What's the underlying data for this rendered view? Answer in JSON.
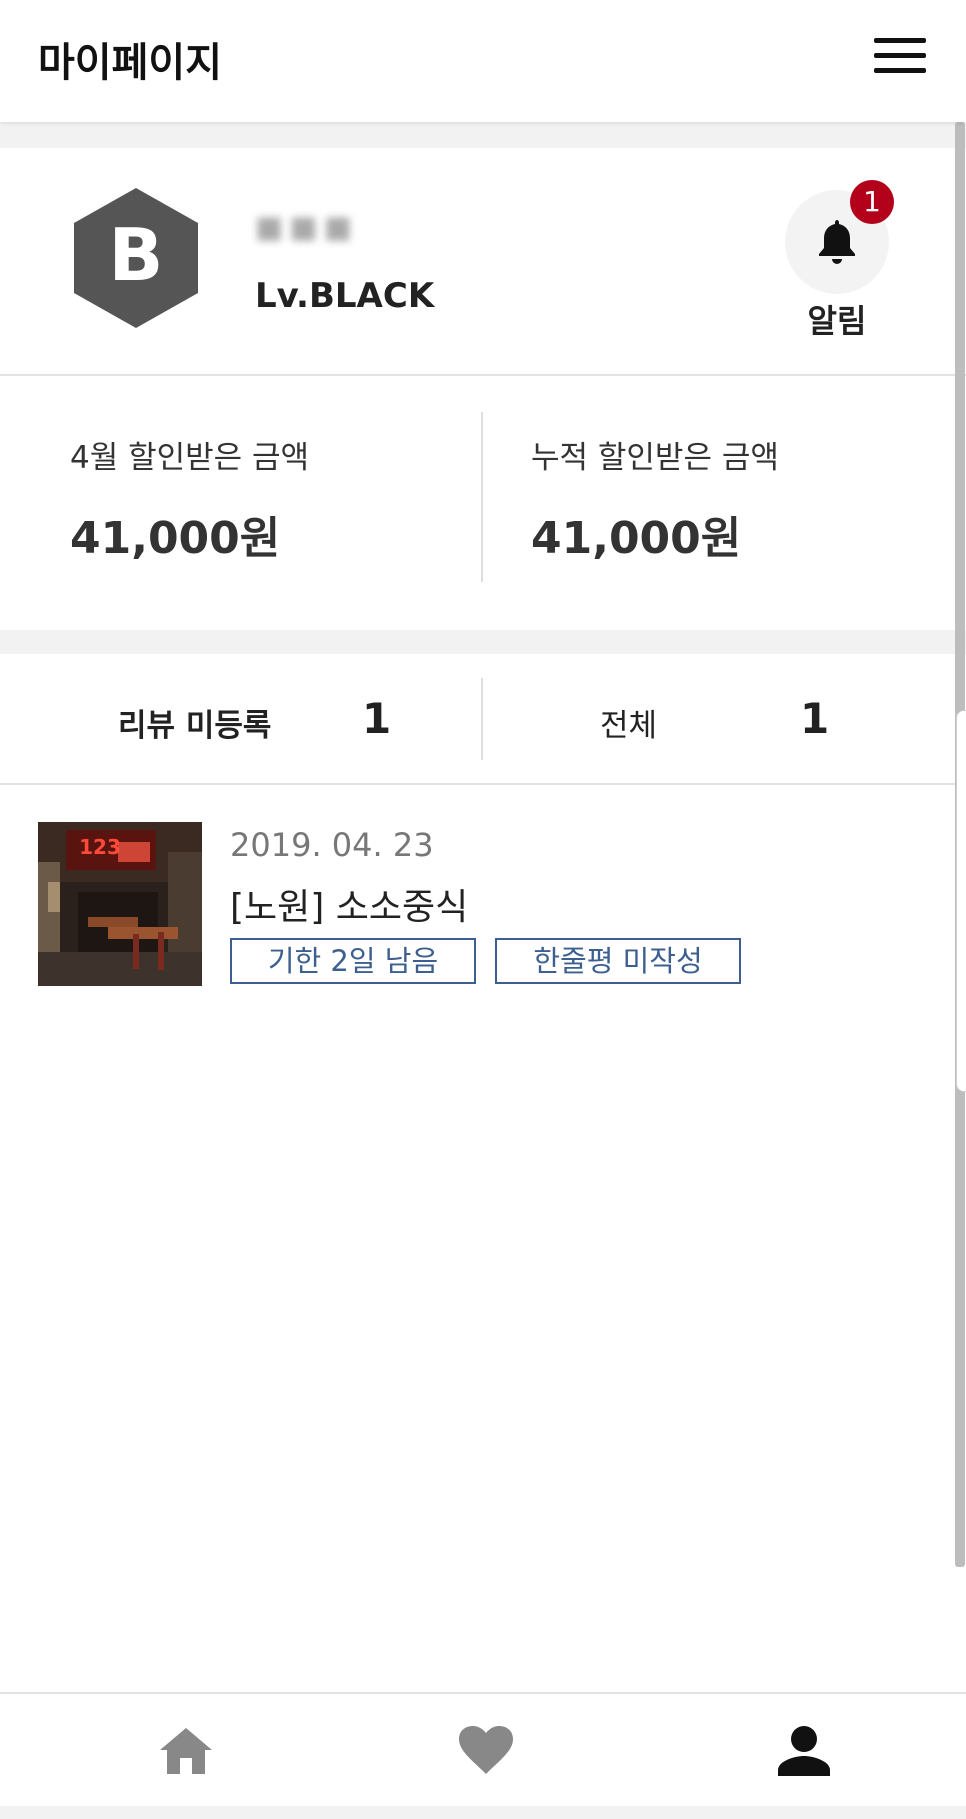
{
  "header": {
    "title": "마이페이지",
    "menu_icon": "hamburger-menu-icon"
  },
  "profile": {
    "grade_letter": "B",
    "user_name": "■■■",
    "level": "Lv.BLACK",
    "alarm_label": "알림",
    "alarm_count": "1",
    "colors": {
      "hex_badge": "#555555",
      "badge": "#b3001b"
    }
  },
  "stats": [
    {
      "label": "4월 할인받은 금액",
      "value": "41,000원"
    },
    {
      "label": "누적 할인받은 금액",
      "value": "41,000원"
    }
  ],
  "tabs": [
    {
      "label": "리뷰 미등록",
      "count": "1"
    },
    {
      "label": "전체",
      "count": "1"
    }
  ],
  "reviews": [
    {
      "date": "2019. 04. 23",
      "title": "[노원] 소소중식",
      "tags": [
        "기한 2일 남음",
        "한줄평 미작성"
      ],
      "thumb_text": "123"
    }
  ],
  "bottom_nav": [
    {
      "icon": "home-icon",
      "active": false
    },
    {
      "icon": "heart-icon",
      "active": false
    },
    {
      "icon": "person-icon",
      "active": true
    }
  ],
  "colors": {
    "tag": "#3d5f8f",
    "accent_red": "#b3001b"
  }
}
